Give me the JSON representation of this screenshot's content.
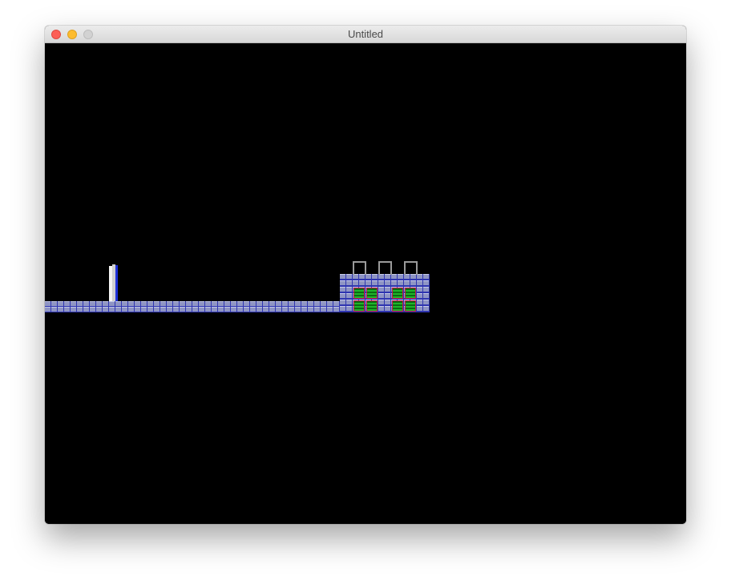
{
  "window": {
    "title": "Untitled"
  },
  "traffic_lights": [
    "close",
    "minimize",
    "zoom"
  ],
  "scene": {
    "background_color": "#000000",
    "brick_color": "#9aa0c6",
    "castle_window_color": "#1fb52a",
    "castle_window_frame_color": "#c5174a",
    "player_color": "#1d2fd6"
  }
}
